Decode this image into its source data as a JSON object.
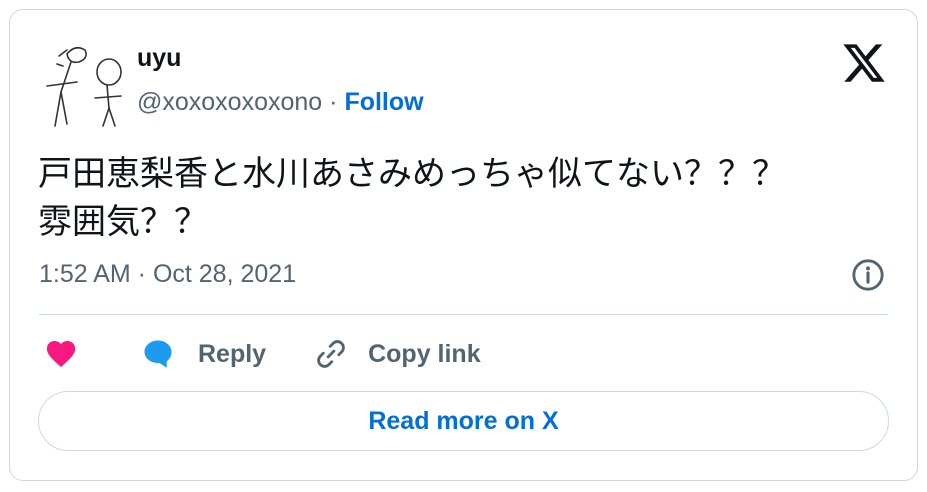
{
  "author": {
    "name": "uyu",
    "handle": "@xoxoxoxoxono",
    "separator": " · ",
    "follow_label": "Follow"
  },
  "icons": {
    "avatar": "stick-figure-drawing-avatar",
    "logo": "x-logo-icon",
    "info": "info-icon",
    "like": "heart-icon",
    "reply": "speech-bubble-icon",
    "copy": "link-icon"
  },
  "tweet": {
    "text": "戸田恵梨香と水川あさみめっちゃ似てない？？？\n雰囲気？？",
    "timestamp": "1:52 AM · Oct 28, 2021"
  },
  "actions": {
    "reply_label": "Reply",
    "copy_label": "Copy link"
  },
  "read_more_label": "Read more on X",
  "colors": {
    "link": "#006fd6",
    "heart": "#f91880",
    "reply_bubble": "#1d9bf0",
    "secondary_text": "#536471",
    "border": "#cfd9de"
  }
}
